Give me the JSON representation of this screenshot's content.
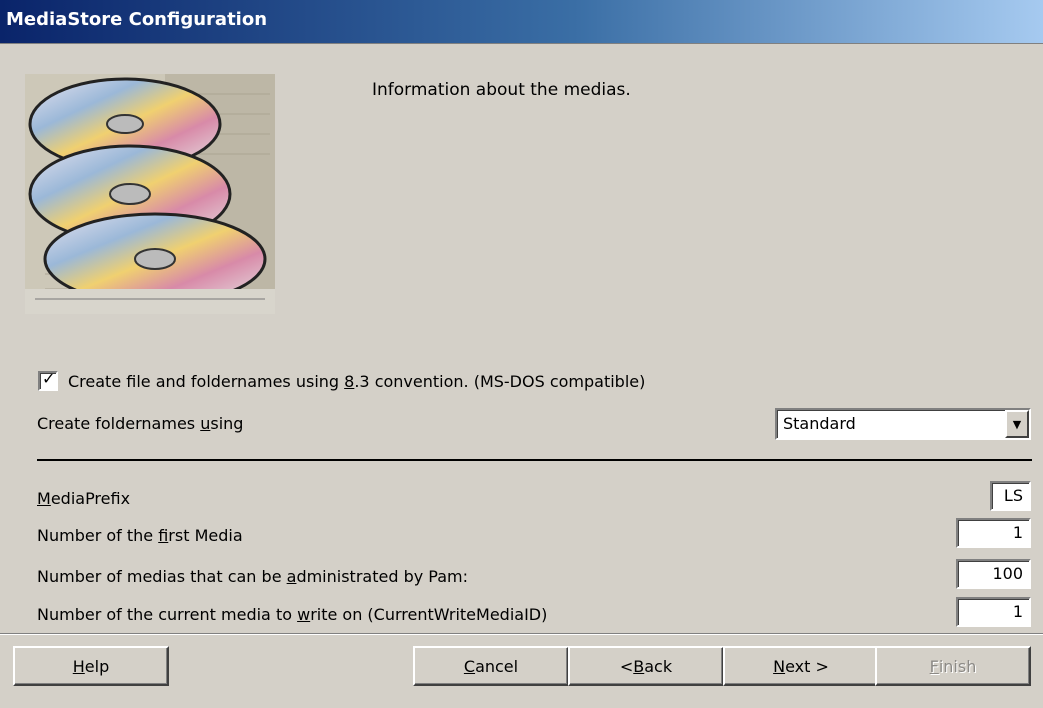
{
  "window": {
    "title": "MediaStore Configuration"
  },
  "info": {
    "text": "Information about the medias."
  },
  "options": {
    "dos_checkbox": {
      "checked": true,
      "label_pre": "Create file and foldernames using ",
      "label_key": "8",
      "label_post": ".3 convention. (MS-DOS compatible)"
    },
    "foldernames": {
      "label_pre": "Create foldernames ",
      "label_key": "u",
      "label_post": "sing",
      "value": "Standard"
    }
  },
  "fields": {
    "media_prefix": {
      "label_pre": "",
      "label_key": "M",
      "label_post": "ediaPrefix",
      "value": "LS"
    },
    "first_media": {
      "label_pre": "Number of the ",
      "label_key": "f",
      "label_post": "irst Media",
      "value": "1"
    },
    "media_count": {
      "label_pre": "Number of medias that can be ",
      "label_key": "a",
      "label_post": "dministrated by Pam:",
      "value": "100"
    },
    "current_media": {
      "label_pre": "Number of the current media to ",
      "label_key": "w",
      "label_post": "rite on (CurrentWriteMediaID)",
      "value": "1"
    }
  },
  "buttons": {
    "help": {
      "key": "H",
      "rest": "elp"
    },
    "cancel": {
      "key": "C",
      "rest": "ancel"
    },
    "back": {
      "pre": "< ",
      "key": "B",
      "rest": "ack"
    },
    "next": {
      "key": "N",
      "rest": "ext >"
    },
    "finish": {
      "key": "F",
      "rest": "inish"
    }
  },
  "icons": {
    "picture": "cd-discs-image",
    "dropdown": "chevron-down-icon",
    "check": "checkmark-icon"
  }
}
